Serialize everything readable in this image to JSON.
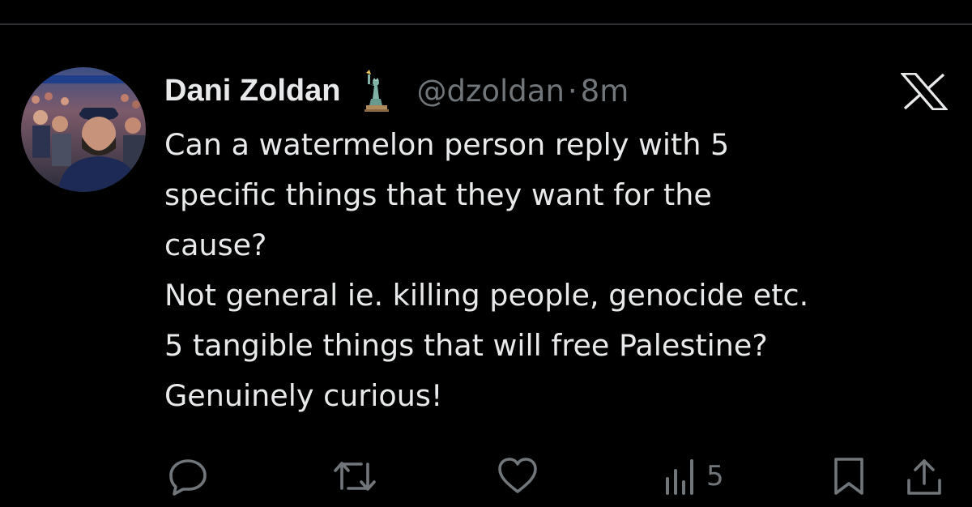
{
  "tweet": {
    "author_name": "Dani Zoldan",
    "author_badge_icon": "statue-of-liberty-icon",
    "handle": "@dzoldan",
    "separator": "·",
    "timestamp": "8m",
    "platform_icon": "x-logo-icon",
    "text_lines": [
      "Can a watermelon person reply with 5",
      "specific things that they want for the",
      "cause?",
      "Not general ie. killing people, genocide etc.",
      "5 tangible things that will free Palestine?",
      "Genuinely curious!"
    ]
  },
  "actions": {
    "reply_icon": "reply-icon",
    "retweet_icon": "retweet-icon",
    "like_icon": "heart-icon",
    "views_icon": "views-icon",
    "views_count": "5",
    "bookmark_icon": "bookmark-icon",
    "share_icon": "share-icon"
  },
  "colors": {
    "background": "#000000",
    "primary_text": "#e7e9ea",
    "secondary_text": "#71767b",
    "divider": "#2f3336"
  }
}
